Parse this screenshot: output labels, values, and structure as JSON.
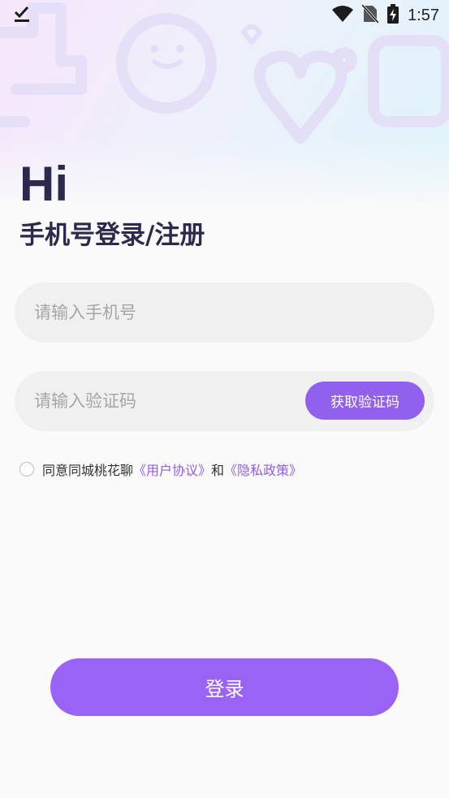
{
  "status_bar": {
    "time": "1:57",
    "icons": [
      "check-download-icon",
      "wifi-icon",
      "no-sim-icon",
      "battery-charging-icon"
    ]
  },
  "header": {
    "greeting": "Hi",
    "title": "手机号登录/注册"
  },
  "form": {
    "phone_placeholder": "请输入手机号",
    "code_placeholder": "请输入验证码",
    "get_code_label": "获取验证码"
  },
  "agreement": {
    "prefix": "同意同城桃花聊",
    "user_agreement": "《用户协议》",
    "conjunction": "和",
    "privacy_policy": "《隐私政策》",
    "checked": false
  },
  "login_label": "登录",
  "colors": {
    "accent": "#9963f5",
    "link": "#8f5ee6",
    "title": "#2b2a4c"
  }
}
